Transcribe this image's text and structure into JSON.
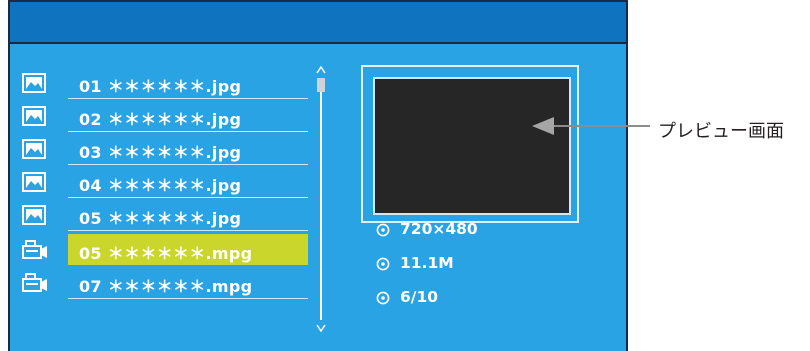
{
  "files": [
    {
      "number": "01",
      "name": "01 ＊＊＊＊＊＊.jpg",
      "type": "image",
      "icon": "image-icon",
      "selected": false
    },
    {
      "number": "02",
      "name": "02 ＊＊＊＊＊＊.jpg",
      "type": "image",
      "icon": "image-icon",
      "selected": false
    },
    {
      "number": "03",
      "name": "03 ＊＊＊＊＊＊.jpg",
      "type": "image",
      "icon": "image-icon",
      "selected": false
    },
    {
      "number": "04",
      "name": "04 ＊＊＊＊＊＊.jpg",
      "type": "image",
      "icon": "image-icon",
      "selected": false
    },
    {
      "number": "05",
      "name": "05 ＊＊＊＊＊＊.jpg",
      "type": "image",
      "icon": "image-icon",
      "selected": false
    },
    {
      "number": "05",
      "name": "05 ＊＊＊＊＊＊.mpg",
      "type": "video",
      "icon": "video-camera-icon",
      "selected": true
    },
    {
      "number": "07",
      "name": "07 ＊＊＊＊＊＊.mpg",
      "type": "video",
      "icon": "video-camera-icon",
      "selected": false
    }
  ],
  "info": {
    "resolution": "720×480",
    "size": "11.1M",
    "position": "6/10"
  },
  "callout": {
    "label": "プレビュー画面"
  },
  "colors": {
    "screen_bg": "#2aa3e4",
    "header_bg": "#0f73bf",
    "selected_bg": "#cbd62c",
    "preview_bg": "#262626"
  }
}
